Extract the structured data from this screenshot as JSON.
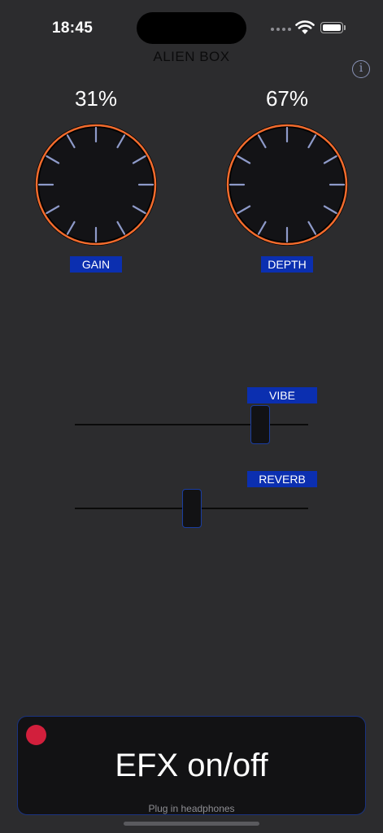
{
  "status": {
    "time": "18:45"
  },
  "app": {
    "title": "ALIEN BOX"
  },
  "knobs": [
    {
      "value_text": "31%",
      "label": "GAIN",
      "level": 0.31
    },
    {
      "value_text": "67%",
      "label": "DEPTH",
      "level": 0.67
    }
  ],
  "sliders": [
    {
      "label": "VIBE",
      "level": 0.82
    },
    {
      "label": "REVERB",
      "level": 0.5
    }
  ],
  "efx": {
    "label": "EFX on/off",
    "hint": "Plug in headphones"
  },
  "colors": {
    "accent": "#f26b2d",
    "label_bg": "#0b2fb0",
    "record": "#d21f3c",
    "background": "#2c2c2e"
  }
}
